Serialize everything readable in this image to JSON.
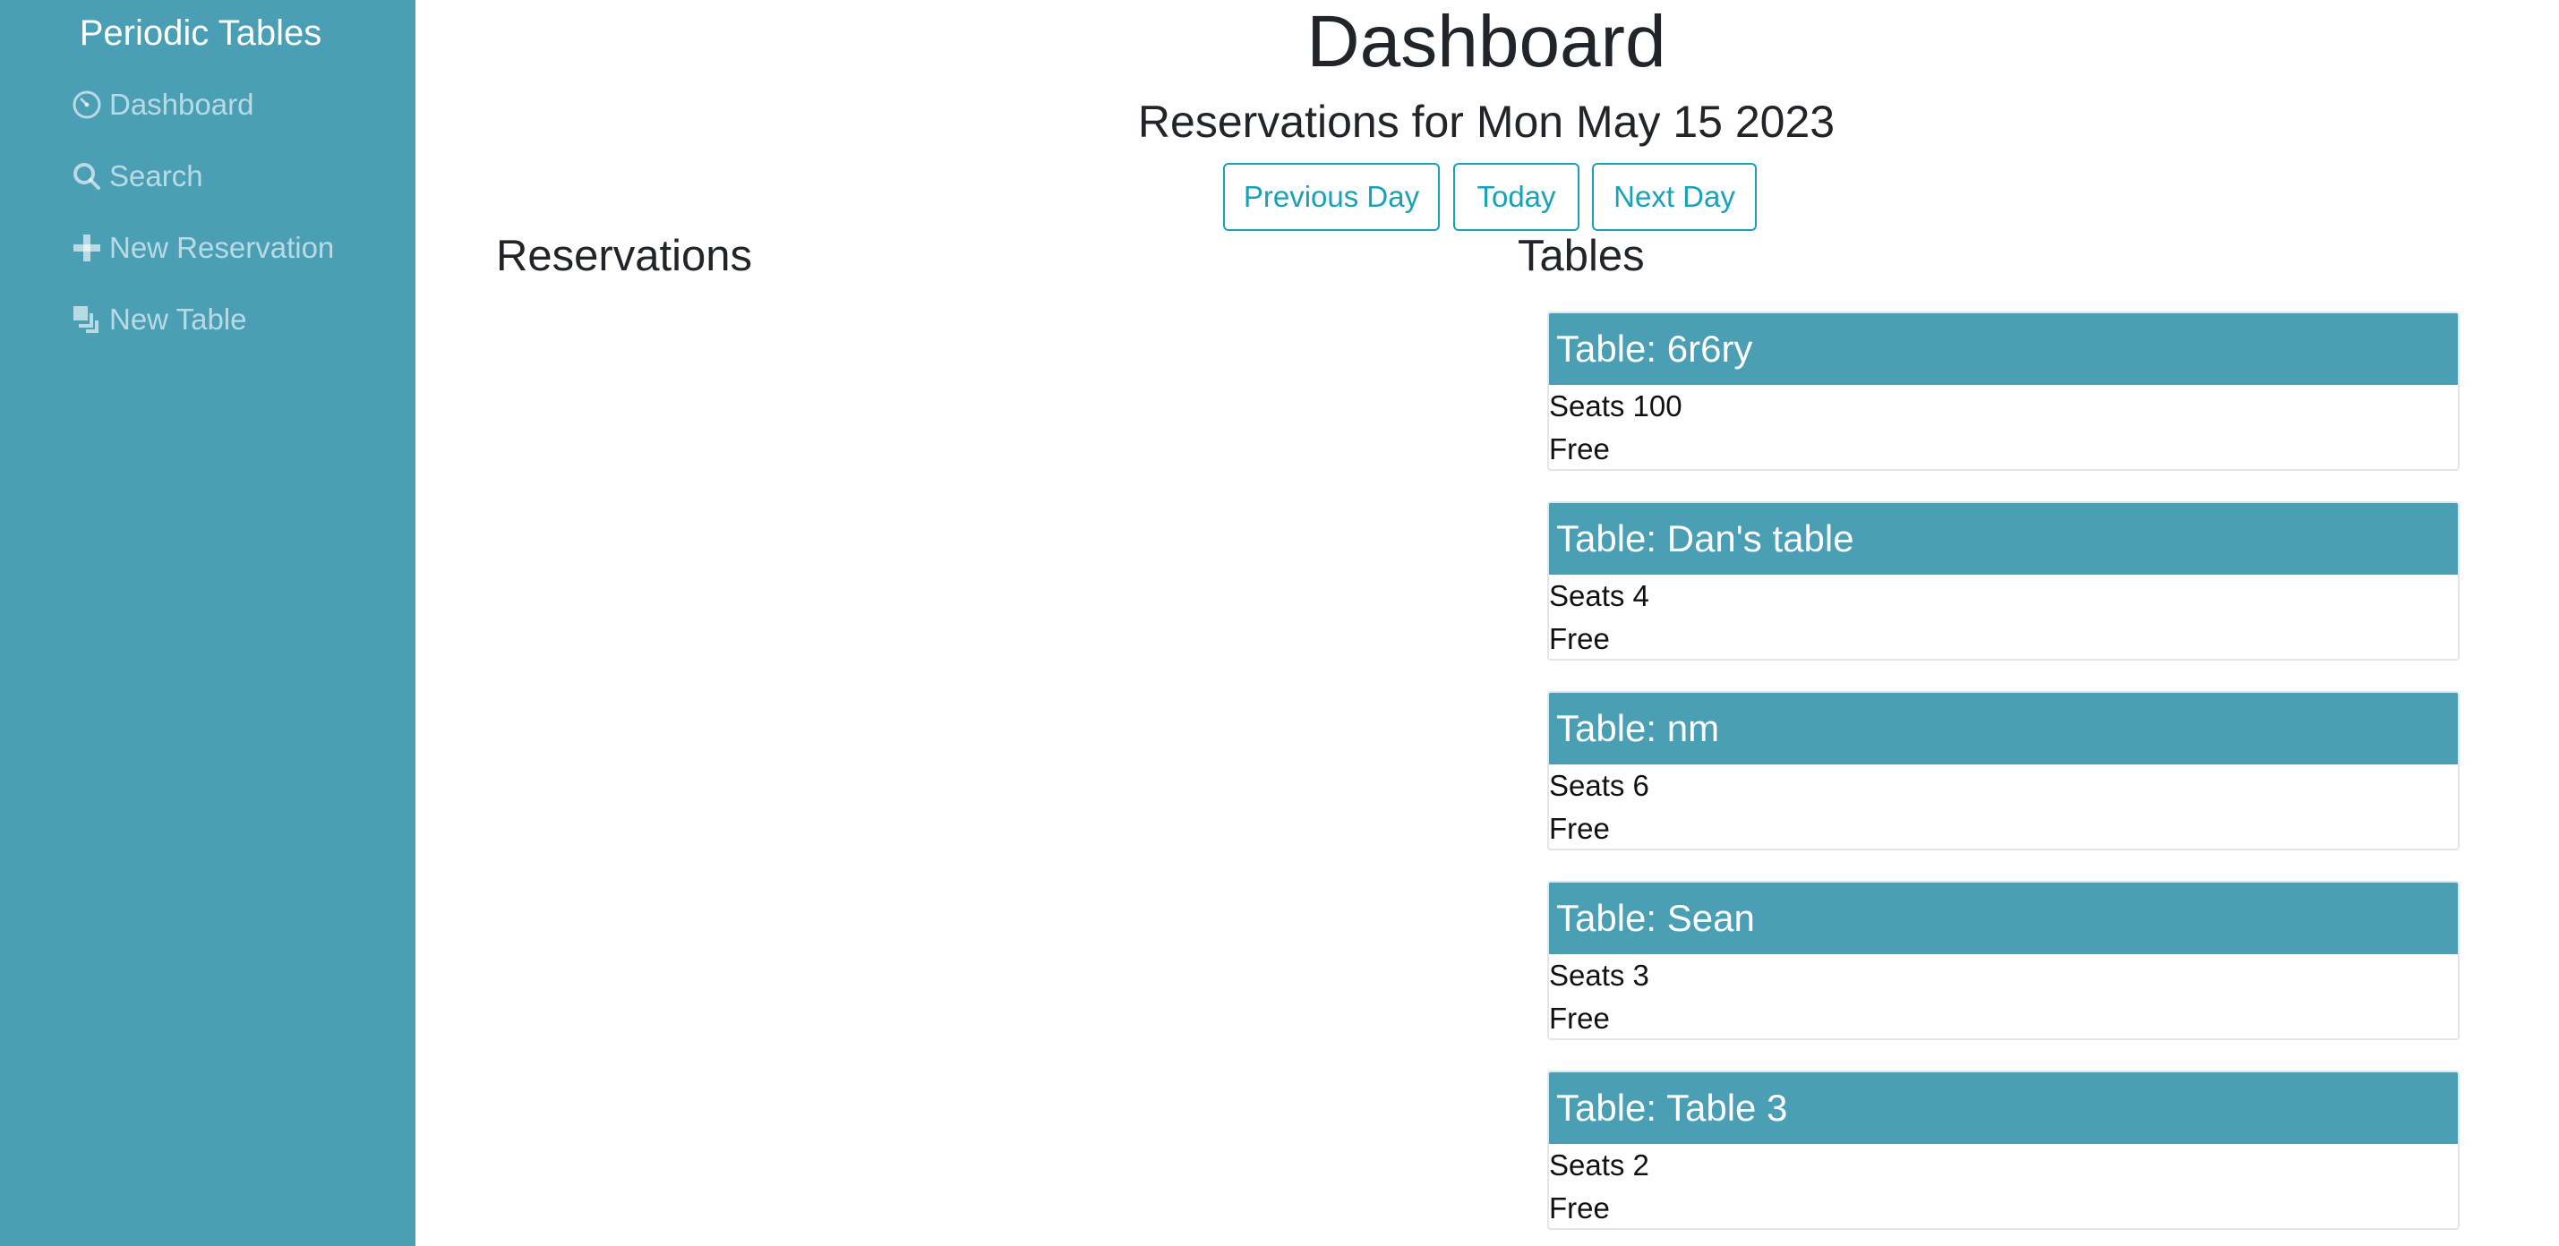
{
  "sidebar": {
    "brand": "Periodic Tables",
    "items": [
      {
        "label": "Dashboard",
        "icon": "dashboard-icon"
      },
      {
        "label": "Search",
        "icon": "search-icon"
      },
      {
        "label": "New Reservation",
        "icon": "plus-icon"
      },
      {
        "label": "New Table",
        "icon": "layers-icon"
      }
    ]
  },
  "main": {
    "title": "Dashboard",
    "date_heading": "Reservations for Mon May 15 2023",
    "buttons": {
      "previous": "Previous Day",
      "today": "Today",
      "next": "Next Day"
    },
    "reservations_heading": "Reservations",
    "tables_heading": "Tables",
    "tables": [
      {
        "title": "Table: 6r6ry",
        "seats": "Seats 100",
        "status": "Free"
      },
      {
        "title": "Table: Dan's table",
        "seats": "Seats 4",
        "status": "Free"
      },
      {
        "title": "Table: nm",
        "seats": "Seats 6",
        "status": "Free"
      },
      {
        "title": "Table: Sean",
        "seats": "Seats 3",
        "status": "Free"
      },
      {
        "title": "Table: Table 3",
        "seats": "Seats 2",
        "status": "Free"
      }
    ]
  },
  "colors": {
    "sidebar_bg": "#4a9fb5",
    "accent": "#17a2b8",
    "card_header_bg": "#4a9fb5"
  }
}
